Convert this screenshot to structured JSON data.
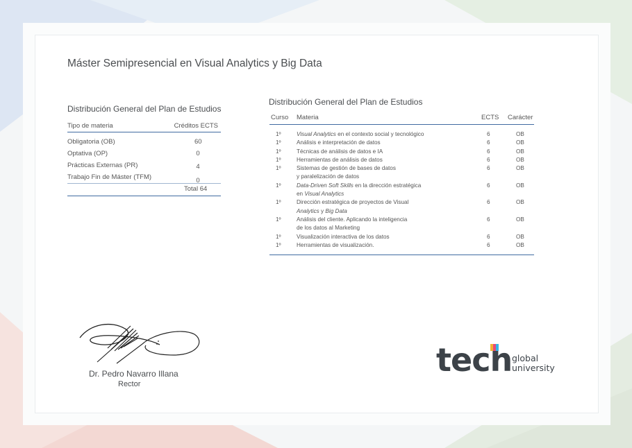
{
  "title": "Máster Semipresencial en  Visual Analytics y Big Data",
  "summary": {
    "title": "Distribución General del Plan de Estudios",
    "col_type": "Tipo de materia",
    "col_credits": "Créditos ECTS",
    "rows": [
      {
        "label": "Obligatoria (OB)",
        "value": "60"
      },
      {
        "label": "Optativa (OP)",
        "value": "0"
      },
      {
        "label": "Prácticas Externas (PR)",
        "value": "4"
      },
      {
        "label": "Trabajo Fin de Máster (TFM)",
        "value": "0"
      }
    ],
    "total": "Total 64"
  },
  "detail": {
    "title": "Distribución General del Plan de Estudios",
    "headers": {
      "curso": "Curso",
      "materia": "Materia",
      "ects": "ECTS",
      "caracter": "Carácter"
    },
    "rows": [
      {
        "curso": "1º",
        "lines": [
          {
            "italic": "Visual Analytics",
            "text": " en el contexto social y tecnológico"
          }
        ],
        "ects": "6",
        "caracter": "OB"
      },
      {
        "curso": "1º",
        "lines": [
          {
            "italic": "",
            "text": "Análisis e interpretación de datos"
          }
        ],
        "ects": "6",
        "caracter": "OB"
      },
      {
        "curso": "1º",
        "lines": [
          {
            "italic": "",
            "text": "Técnicas de análisis de datos e IA"
          }
        ],
        "ects": "6",
        "caracter": "OB"
      },
      {
        "curso": "1º",
        "lines": [
          {
            "italic": "",
            "text": "Herramientas de análisis de datos"
          }
        ],
        "ects": "6",
        "caracter": "OB"
      },
      {
        "curso": "1º",
        "lines": [
          {
            "italic": "",
            "text": "Sistemas de gestión de bases de datos"
          },
          {
            "italic": "",
            "text": "y paralelización de datos"
          }
        ],
        "ects": "6",
        "caracter": "OB"
      },
      {
        "curso": "1º",
        "lines": [
          {
            "italic": "Data-Driven Soft Skills",
            "text": " en la dirección estratégica"
          },
          {
            "prefix": "en ",
            "italic": "Visual Analytics",
            "text": ""
          }
        ],
        "ects": "6",
        "caracter": "OB"
      },
      {
        "curso": "1º",
        "lines": [
          {
            "italic": "",
            "text": "Dirección estratégica de proyectos de Visual"
          },
          {
            "italic": "Analytics",
            "text": " y ",
            "italic2": "Big Data"
          }
        ],
        "ects": "6",
        "caracter": "OB"
      },
      {
        "curso": "1º",
        "lines": [
          {
            "italic": "",
            "text": "Análisis del cliente. Aplicando la inteligencia"
          },
          {
            "italic": "",
            "text": "de los datos al Marketing"
          }
        ],
        "ects": "6",
        "caracter": "OB"
      },
      {
        "curso": "1º",
        "lines": [
          {
            "italic": "",
            "text": "Visualización interactiva de los datos"
          }
        ],
        "ects": "6",
        "caracter": "OB"
      },
      {
        "curso": "1º",
        "lines": [
          {
            "italic": "",
            "text": "Herramientas de visualización."
          }
        ],
        "ects": "6",
        "caracter": "OB"
      }
    ]
  },
  "signature": {
    "name": "Dr. Pedro Navarro Illana",
    "role": "Rector"
  },
  "logo": {
    "word": "tech",
    "line1": "global",
    "line2": "university"
  },
  "colors": {
    "accent_line": "#3f6aa0",
    "text": "#4a4d50"
  }
}
